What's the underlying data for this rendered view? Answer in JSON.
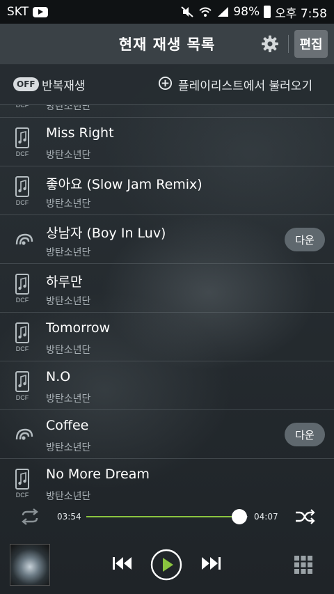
{
  "status_bar": {
    "carrier": "SKT",
    "battery": "98%",
    "time": "오후 7:58",
    "icons": [
      "youtube-icon",
      "mute-icon",
      "wifi-icon",
      "signal-icon",
      "battery-icon"
    ]
  },
  "header": {
    "title": "현재 재생 목록",
    "edit_label": "편집"
  },
  "toolbar": {
    "repeat_toggle": "OFF",
    "repeat_label": "반복재생",
    "load_playlist_label": "플레이리스트에서 불러오기"
  },
  "playlist": {
    "partial_artist": "방탄소년단",
    "items": [
      {
        "title": "Miss Right",
        "artist": "방탄소년단",
        "type": "dcf",
        "download": ""
      },
      {
        "title": "좋아요 (Slow Jam Remix)",
        "artist": "방탄소년단",
        "type": "dcf",
        "download": ""
      },
      {
        "title": "상남자 (Boy In Luv)",
        "artist": "방탄소년단",
        "type": "stream",
        "download": "다운"
      },
      {
        "title": "하루만",
        "artist": "방탄소년단",
        "type": "dcf",
        "download": ""
      },
      {
        "title": "Tomorrow",
        "artist": "방탄소년단",
        "type": "dcf",
        "download": ""
      },
      {
        "title": "N.O",
        "artist": "방탄소년단",
        "type": "dcf",
        "download": ""
      },
      {
        "title": "Coffee",
        "artist": "방탄소년단",
        "type": "stream",
        "download": "다운"
      },
      {
        "title": "No More Dream",
        "artist": "방탄소년단",
        "type": "dcf",
        "download": ""
      }
    ],
    "dcf_label": "DCF"
  },
  "player": {
    "current_time": "03:54",
    "total_time": "04:07",
    "progress_fraction": 0.947,
    "accent_color": "#8ac43f"
  }
}
